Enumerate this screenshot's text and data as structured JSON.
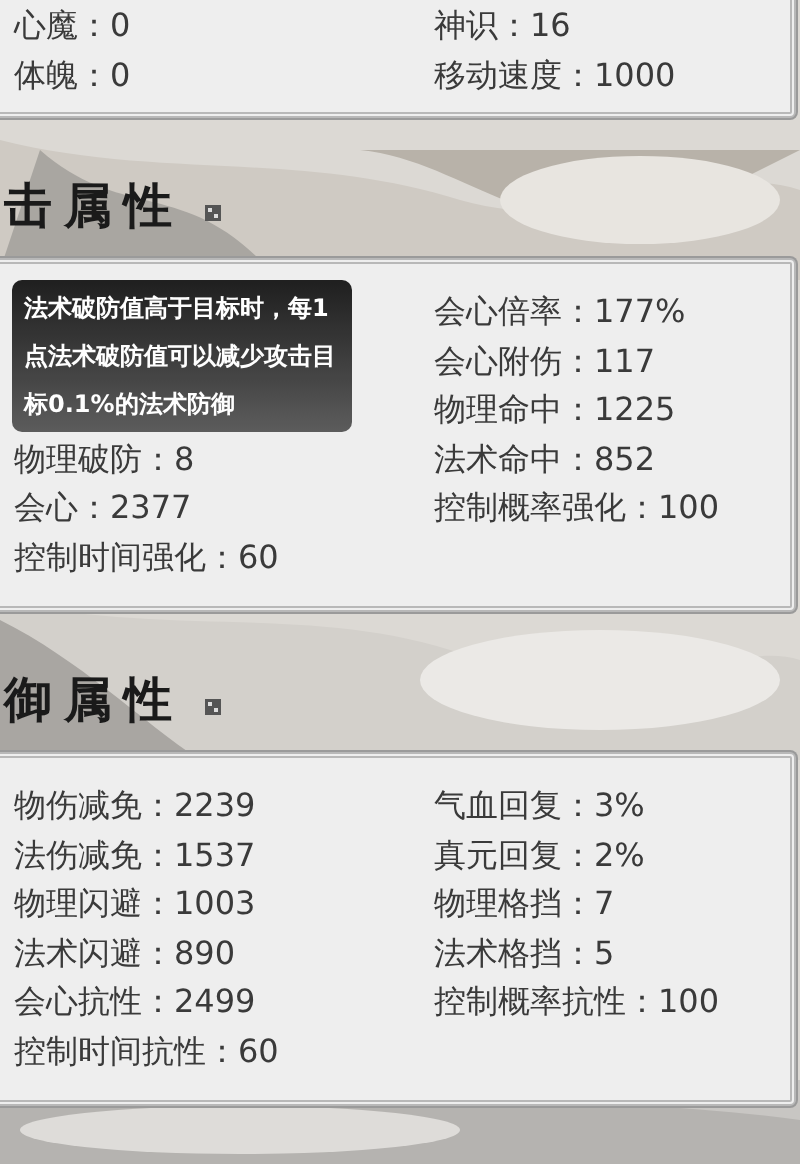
{
  "sections": [
    {
      "left": [
        {
          "label": "心魔：",
          "value": "0"
        },
        {
          "label": "体魄：",
          "value": "0"
        }
      ],
      "right": [
        {
          "label": "神识：",
          "value": "16"
        },
        {
          "label": "移动速度：",
          "value": "1000"
        }
      ]
    },
    {
      "heading": "击属性",
      "tooltip": "法术破防值高于目标时，每1点法术破防值可以减少攻击目标0.1%的法术防御",
      "left": [
        {
          "label": "物理破防：",
          "value": "8"
        },
        {
          "label": "会心：",
          "value": "2377"
        },
        {
          "label": "控制时间强化：",
          "value": "60"
        }
      ],
      "right": [
        {
          "label": "会心倍率：",
          "value": "177%"
        },
        {
          "label": "会心附伤：",
          "value": "117"
        },
        {
          "label": "物理命中：",
          "value": "1225"
        },
        {
          "label": "法术命中：",
          "value": "852"
        },
        {
          "label": "控制概率强化：",
          "value": "100"
        }
      ]
    },
    {
      "heading": "御属性",
      "left": [
        {
          "label": "物伤减免：",
          "value": "2239"
        },
        {
          "label": "法伤减免：",
          "value": "1537"
        },
        {
          "label": "物理闪避：",
          "value": "1003"
        },
        {
          "label": "法术闪避：",
          "value": "890"
        },
        {
          "label": "会心抗性：",
          "value": "2499"
        },
        {
          "label": "控制时间抗性：",
          "value": "60"
        }
      ],
      "right": [
        {
          "label": "气血回复：",
          "value": "3%"
        },
        {
          "label": "真元回复：",
          "value": "2%"
        },
        {
          "label": "物理格挡：",
          "value": "7"
        },
        {
          "label": "法术格挡：",
          "value": "5"
        },
        {
          "label": "控制概率抗性：",
          "value": "100"
        }
      ]
    }
  ]
}
